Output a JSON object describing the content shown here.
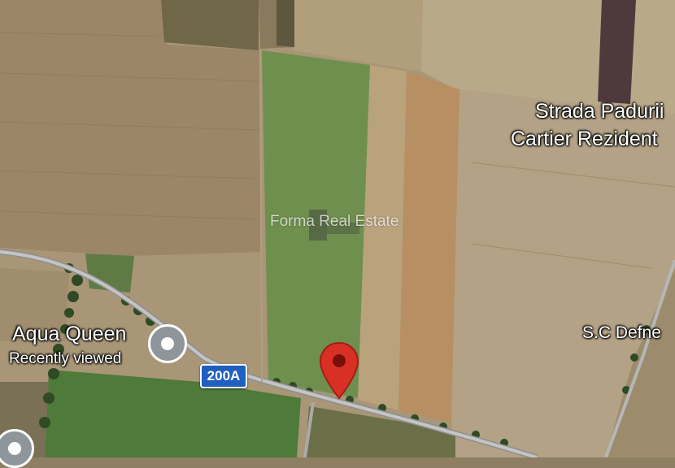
{
  "map": {
    "type": "satellite",
    "places": [
      {
        "name": "Strada Padurii"
      },
      {
        "name": "Cartier Rezident"
      },
      {
        "name": "S.C Defne"
      },
      {
        "name": "Aqua Queen",
        "subtitle": "Recently viewed"
      }
    ],
    "road_shield": "200A",
    "watermark": "Forma Real Estate",
    "selected_pin_color": "#d93025",
    "history_pin_color": "#8e959b",
    "road_shield_color": "#1f5fbf"
  }
}
